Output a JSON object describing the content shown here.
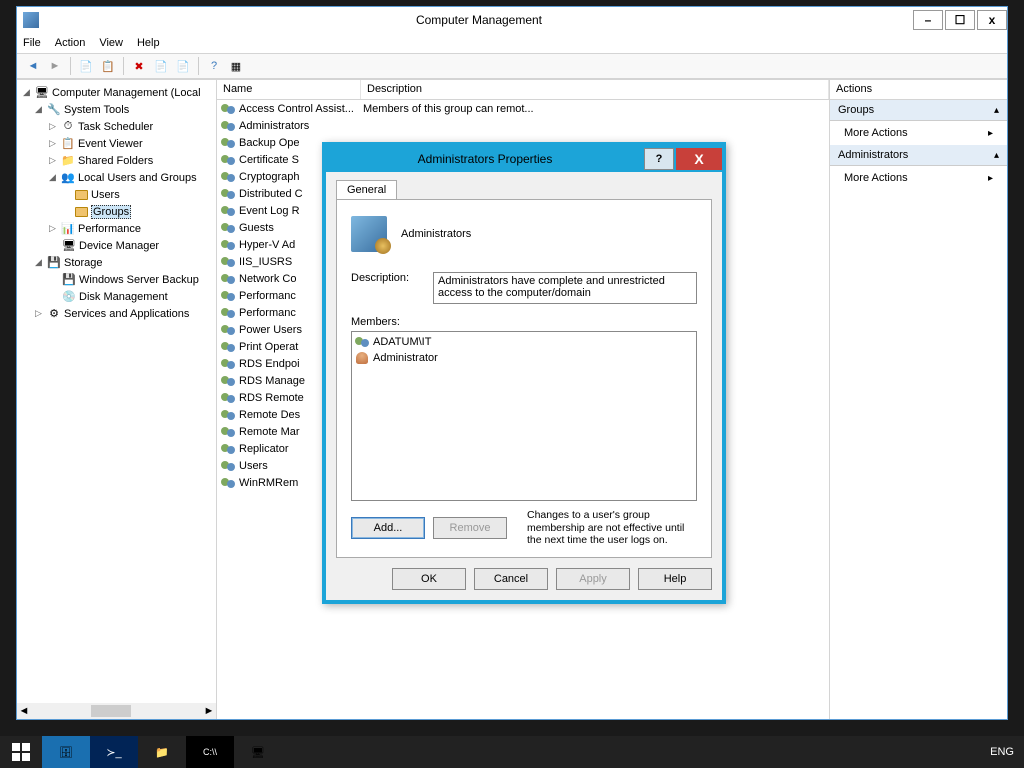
{
  "window": {
    "title": "Computer Management",
    "minimize": "–",
    "maximize": "☐",
    "close": "x"
  },
  "menubar": [
    "File",
    "Action",
    "View",
    "Help"
  ],
  "tree": {
    "root": "Computer Management (Local",
    "systools": "System Tools",
    "task": "Task Scheduler",
    "event": "Event Viewer",
    "shared": "Shared Folders",
    "lug": "Local Users and Groups",
    "users": "Users",
    "groups": "Groups",
    "perf": "Performance",
    "devmgr": "Device Manager",
    "storage": "Storage",
    "wsbackup": "Windows Server Backup",
    "diskmgmt": "Disk Management",
    "services": "Services and Applications"
  },
  "list": {
    "col_name": "Name",
    "col_desc": "Description",
    "rows": [
      {
        "n": "Access Control Assist...",
        "d": "Members of this group can remot..."
      },
      {
        "n": "Administrators",
        "d": ""
      },
      {
        "n": "Backup Ope",
        "d": ""
      },
      {
        "n": "Certificate S",
        "d": ""
      },
      {
        "n": "Cryptograph",
        "d": ""
      },
      {
        "n": "Distributed C",
        "d": ""
      },
      {
        "n": "Event Log R",
        "d": ""
      },
      {
        "n": "Guests",
        "d": ""
      },
      {
        "n": "Hyper-V Ad",
        "d": ""
      },
      {
        "n": "IIS_IUSRS",
        "d": ""
      },
      {
        "n": "Network Co",
        "d": ""
      },
      {
        "n": "Performanc",
        "d": ""
      },
      {
        "n": "Performanc",
        "d": ""
      },
      {
        "n": "Power Users",
        "d": ""
      },
      {
        "n": "Print Operat",
        "d": ""
      },
      {
        "n": "RDS Endpoi",
        "d": ""
      },
      {
        "n": "RDS Manage",
        "d": ""
      },
      {
        "n": "RDS Remote",
        "d": ""
      },
      {
        "n": "Remote Des",
        "d": ""
      },
      {
        "n": "Remote Mar",
        "d": ""
      },
      {
        "n": "Replicator",
        "d": ""
      },
      {
        "n": "Users",
        "d": ""
      },
      {
        "n": "WinRMRem",
        "d": ""
      }
    ]
  },
  "actions": {
    "title": "Actions",
    "section1": "Groups",
    "item1": "More Actions",
    "section2": "Administrators",
    "item2": "More Actions"
  },
  "dialog": {
    "title": "Administrators Properties",
    "help": "?",
    "close": "X",
    "tab_general": "General",
    "group_name": "Administrators",
    "desc_label": "Description:",
    "desc_value": "Administrators have complete and unrestricted access to the computer/domain",
    "members_label": "Members:",
    "members": [
      "ADATUM\\IT",
      "Administrator"
    ],
    "add": "Add...",
    "remove": "Remove",
    "note": "Changes to a user's group membership are not effective until the next time the user logs on.",
    "ok": "OK",
    "cancel": "Cancel",
    "apply": "Apply",
    "help_btn": "Help"
  },
  "taskbar": {
    "lang": "ENG"
  }
}
